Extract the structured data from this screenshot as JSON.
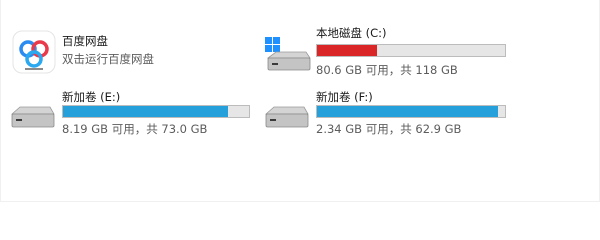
{
  "colors": {
    "normal_fill": "#26a0da",
    "warning_fill": "#da2626",
    "bar_track": "#e6e6e6",
    "bar_border": "#bcbcbc"
  },
  "items": [
    {
      "name": "百度网盘",
      "subtitle": "双击运行百度网盘",
      "icon": "baidu-netdisk-icon"
    },
    {
      "name": "本地磁盘 (C:)",
      "capacity_text": "80.6 GB 可用，共 118 GB",
      "used_fraction": 0.317,
      "status": "warning",
      "icon": "windows-drive-icon"
    },
    {
      "name": "新加卷 (E:)",
      "capacity_text": "8.19 GB 可用，共 73.0 GB",
      "used_fraction": 0.888,
      "status": "normal",
      "icon": "drive-icon"
    },
    {
      "name": "新加卷 (F:)",
      "capacity_text": "2.34 GB 可用，共 62.9 GB",
      "used_fraction": 0.963,
      "status": "normal",
      "icon": "drive-icon"
    }
  ]
}
